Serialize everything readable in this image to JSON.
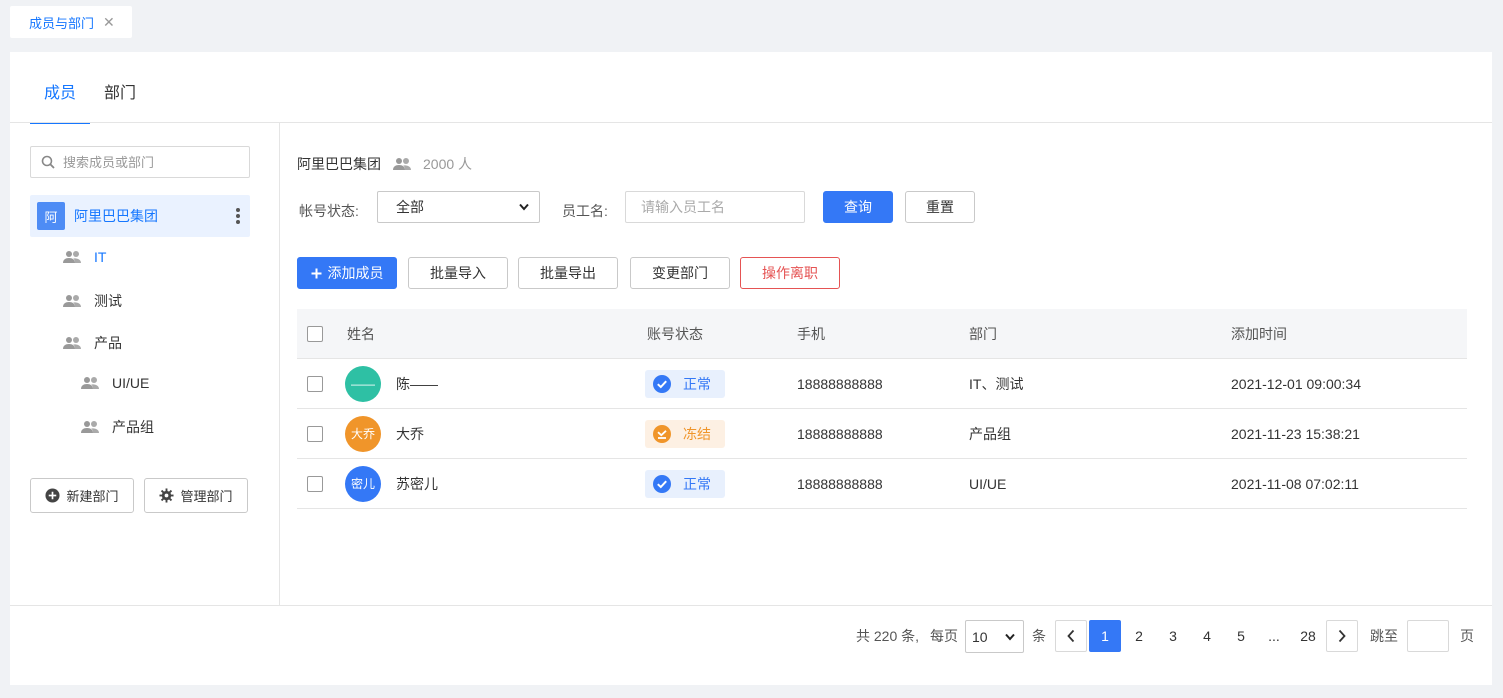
{
  "top_tab": {
    "label": "成员与部门",
    "close": "✕"
  },
  "main_tabs": [
    {
      "label": "成员",
      "active": true
    },
    {
      "label": "部门",
      "active": false
    }
  ],
  "sidebar": {
    "search_placeholder": "搜索成员或部门",
    "org": {
      "avatar_text": "阿",
      "name": "阿里巴巴集团"
    },
    "departments": [
      {
        "label": "IT",
        "active": true
      },
      {
        "label": "测试",
        "active": false
      },
      {
        "label": "产品",
        "active": false
      },
      {
        "label": "UI/UE",
        "active": false
      },
      {
        "label": "产品组",
        "active": false
      }
    ],
    "new_dept_label": "新建部门",
    "manage_dept_label": "管理部门"
  },
  "content": {
    "org_name": "阿里巴巴集团",
    "member_count": "2000 人",
    "filters": {
      "status_label": "帐号状态:",
      "status_value": "全部",
      "name_label": "员工名:",
      "name_placeholder": "请输入员工名",
      "query_label": "查询",
      "reset_label": "重置"
    },
    "actions": {
      "add": "添加成员",
      "import": "批量导入",
      "export": "批量导出",
      "change_dept": "变更部门",
      "resign": "操作离职"
    },
    "table": {
      "headers": [
        "姓名",
        "账号状态",
        "手机",
        "部门",
        "添加时间"
      ],
      "rows": [
        {
          "avatar": "——",
          "avatar_color": "#2ec0a4",
          "name": "陈——",
          "status": "正常",
          "status_type": "normal",
          "phone": "18888888888",
          "dept": "IT、测试",
          "time": "2021-12-01 09:00:34"
        },
        {
          "avatar": "大乔",
          "avatar_color": "#f0952a",
          "name": "大乔",
          "status": "冻结",
          "status_type": "frozen",
          "phone": "18888888888",
          "dept": "产品组",
          "time": "2021-11-23 15:38:21"
        },
        {
          "avatar": "密儿",
          "avatar_color": "#3478f6",
          "name": "苏密儿",
          "status": "正常",
          "status_type": "normal",
          "phone": "18888888888",
          "dept": "UI/UE",
          "time": "2021-11-08 07:02:11"
        }
      ]
    }
  },
  "pagination": {
    "total_text": "共 220 条,",
    "per_page_label": "每页",
    "per_page_value": "10",
    "unit": "条",
    "pages": [
      "1",
      "2",
      "3",
      "4",
      "5",
      "...",
      "28"
    ],
    "current": "1",
    "jump_label": "跳至",
    "page_unit": "页"
  },
  "colors": {
    "primary": "#3478f6",
    "danger": "#e55353",
    "normal_bg": "#e8f0fd",
    "frozen_bg": "#fdf0e3",
    "frozen_text": "#f0952a"
  }
}
